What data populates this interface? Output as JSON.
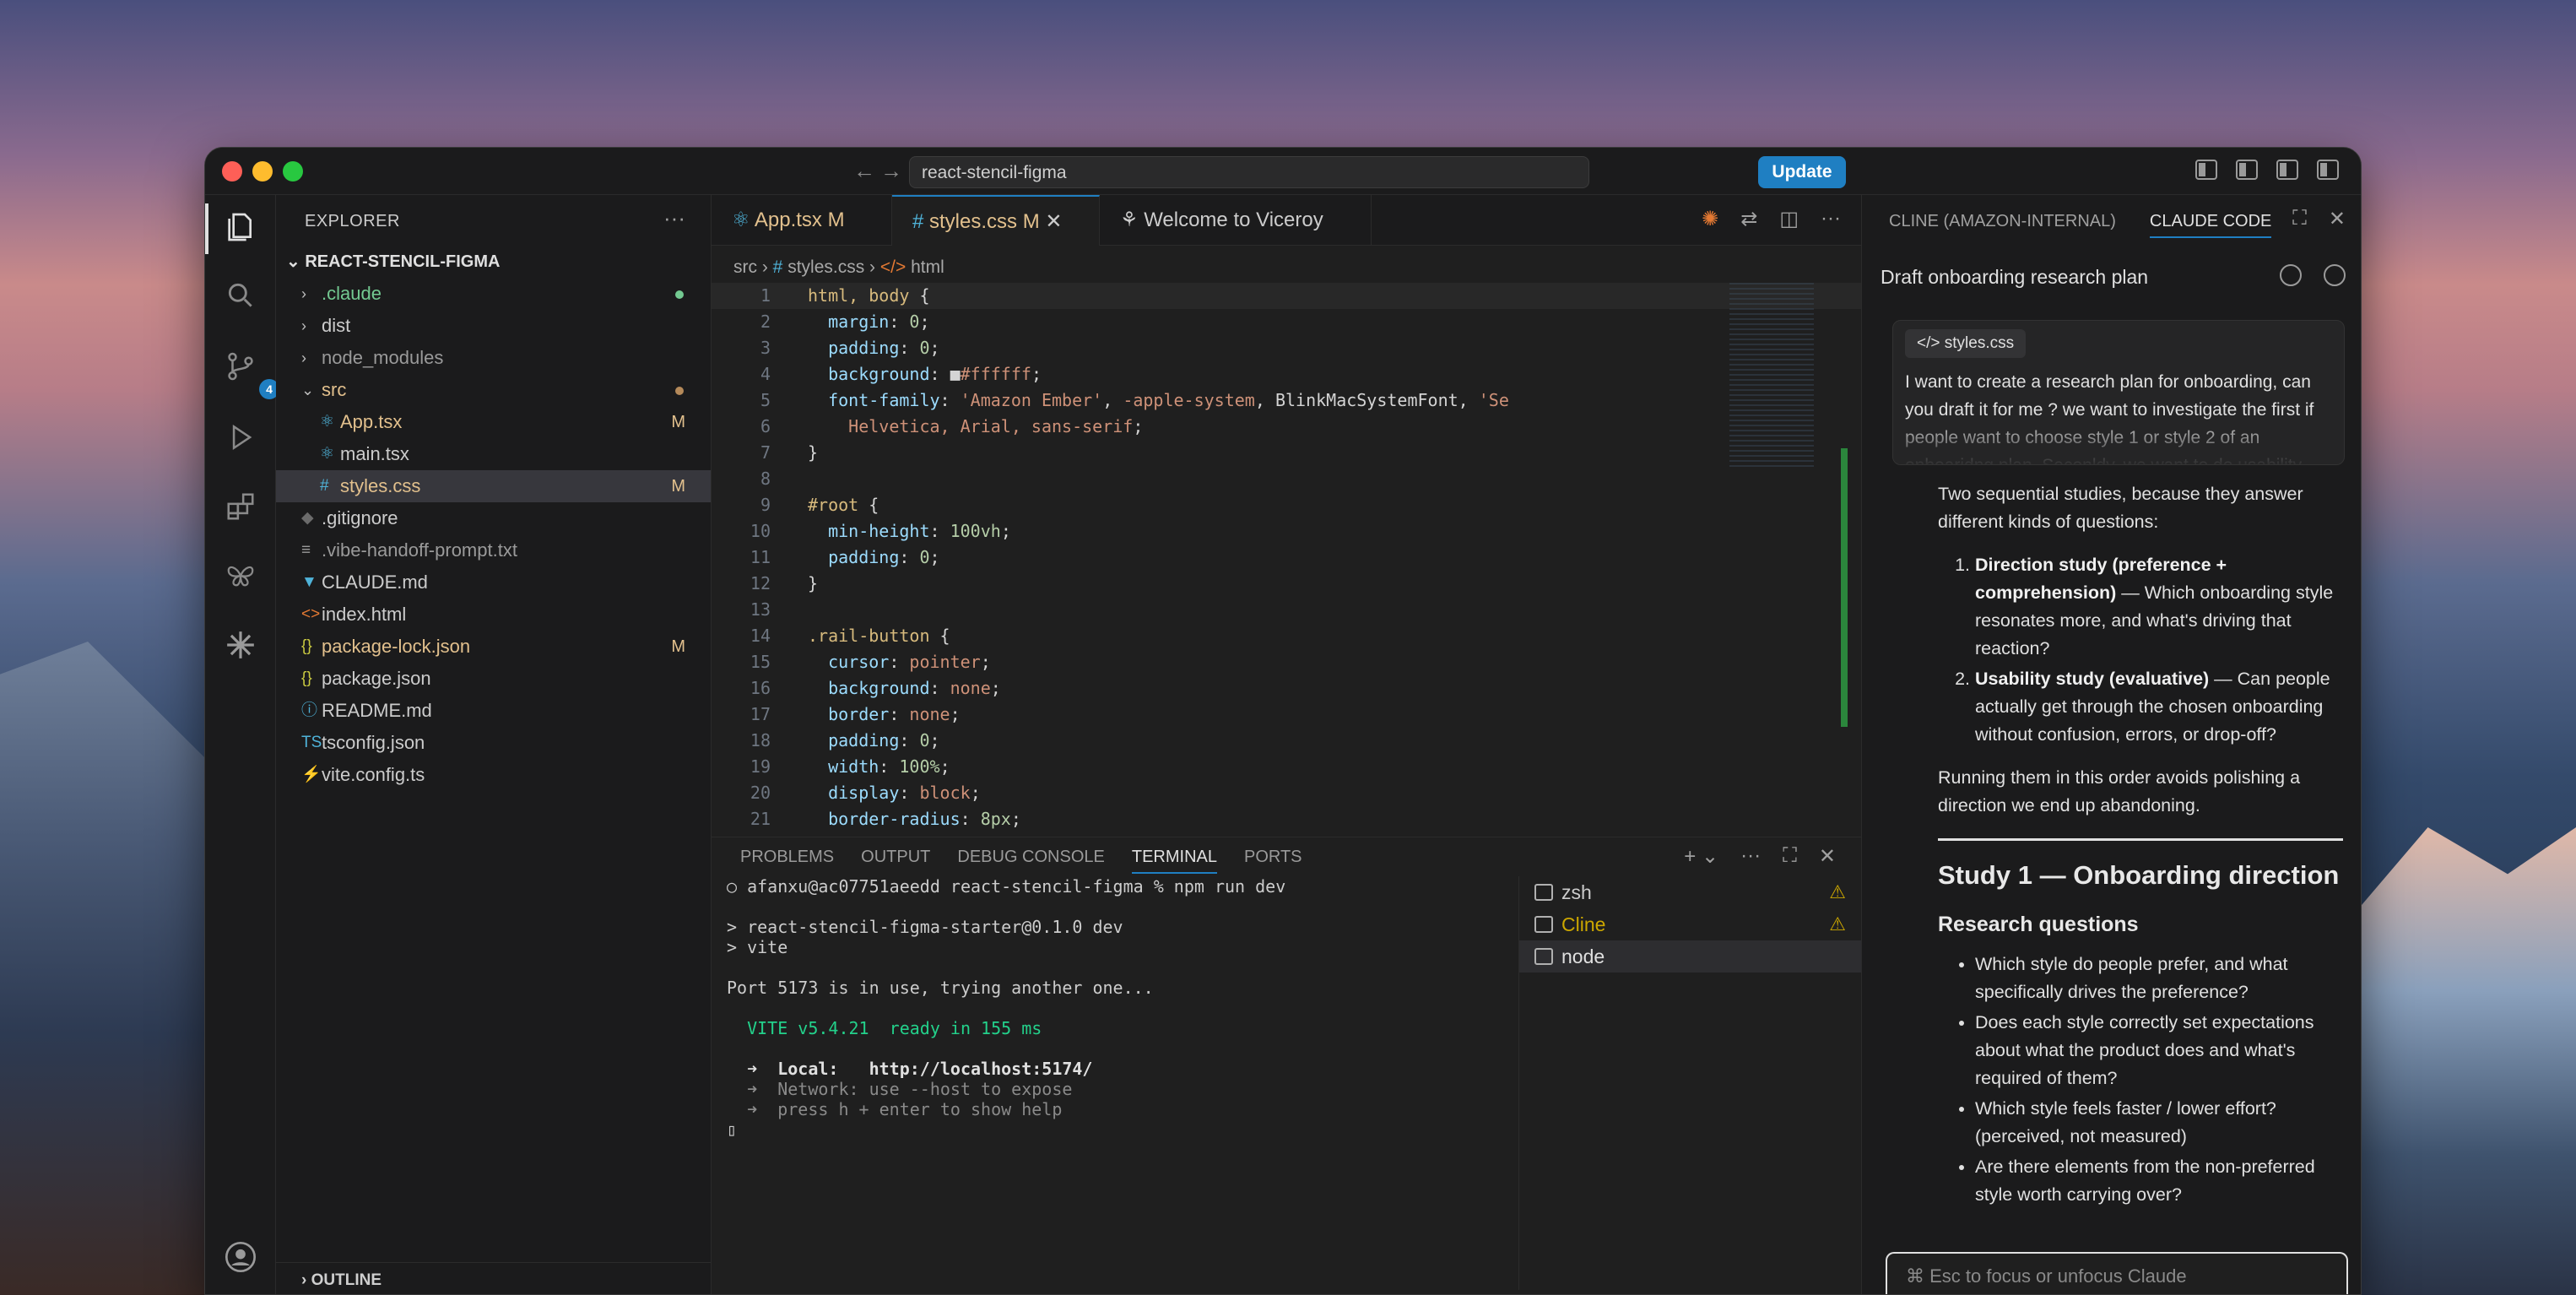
{
  "window": {
    "search_text": "react-stencil-figma",
    "update_label": "Update",
    "nav_back": "←",
    "nav_forward": "→"
  },
  "activity": {
    "source_control_badge": "4"
  },
  "sidebar": {
    "title": "EXPLORER",
    "more": "···",
    "root": "REACT-STENCIL-FIGMA",
    "outline": "OUTLINE",
    "items": [
      {
        "name": ".claude",
        "kind": "folder",
        "color": "#73c991",
        "dot": "#73c991"
      },
      {
        "name": "dist",
        "kind": "folder",
        "color": "#cccccc"
      },
      {
        "name": "node_modules",
        "kind": "folder",
        "color": "#9a9a9a"
      },
      {
        "name": "src",
        "kind": "folder-open",
        "color": "#e2c08d",
        "dot": "#b58a5a"
      },
      {
        "name": "App.tsx",
        "kind": "file",
        "icon": "⚛",
        "icon_color": "#4fb3d9",
        "color": "#e2c08d",
        "mark": "M"
      },
      {
        "name": "main.tsx",
        "kind": "file",
        "icon": "⚛",
        "icon_color": "#4fb3d9",
        "color": "#cccccc"
      },
      {
        "name": "styles.css",
        "kind": "file",
        "icon": "#",
        "icon_color": "#4fb3d9",
        "color": "#e2c08d",
        "mark": "M",
        "selected": true
      },
      {
        "name": ".gitignore",
        "kind": "file",
        "icon": "◆",
        "icon_color": "#6b6b6b",
        "color": "#cccccc"
      },
      {
        "name": ".vibe-handoff-prompt.txt",
        "kind": "file",
        "icon": "≡",
        "icon_color": "#9a9a9a",
        "color": "#9a9a9a"
      },
      {
        "name": "CLAUDE.md",
        "kind": "file",
        "icon": "▼",
        "icon_color": "#4fb3d9",
        "color": "#cccccc"
      },
      {
        "name": "index.html",
        "kind": "file",
        "icon": "<>",
        "icon_color": "#e37933",
        "color": "#cccccc"
      },
      {
        "name": "package-lock.json",
        "kind": "file",
        "icon": "{}",
        "icon_color": "#cbcb41",
        "color": "#e2c08d",
        "mark": "M"
      },
      {
        "name": "package.json",
        "kind": "file",
        "icon": "{}",
        "icon_color": "#cbcb41",
        "color": "#cccccc"
      },
      {
        "name": "README.md",
        "kind": "file",
        "icon": "ⓘ",
        "icon_color": "#4fb3d9",
        "color": "#cccccc"
      },
      {
        "name": "tsconfig.json",
        "kind": "file",
        "icon": "TS",
        "icon_color": "#4fb3d9",
        "color": "#cccccc"
      },
      {
        "name": "vite.config.ts",
        "kind": "file",
        "icon": "⚡",
        "icon_color": "#f0c000",
        "color": "#cccccc"
      }
    ]
  },
  "editor": {
    "tabs": [
      {
        "label": "App.tsx",
        "mark": "M",
        "color": "#e2c08d"
      },
      {
        "label": "styles.css",
        "mark": "M",
        "close": "✕",
        "color": "#e2c08d",
        "active": true
      },
      {
        "label": "Welcome to Viceroy",
        "color": "#cccccc"
      }
    ],
    "breadcrumb": [
      "src",
      "styles.css",
      "html"
    ],
    "code": [
      {
        "n": "1",
        "parts": [
          [
            "k-sel",
            "html, body "
          ],
          [
            "k-pun",
            "{"
          ]
        ]
      },
      {
        "n": "2",
        "parts": [
          [
            "k-prop",
            "  margin"
          ],
          [
            "k-pun",
            ": "
          ],
          [
            "k-num",
            "0"
          ],
          [
            "k-pun",
            ";"
          ]
        ]
      },
      {
        "n": "3",
        "parts": [
          [
            "k-prop",
            "  padding"
          ],
          [
            "k-pun",
            ": "
          ],
          [
            "k-num",
            "0"
          ],
          [
            "k-pun",
            ";"
          ]
        ]
      },
      {
        "n": "4",
        "parts": [
          [
            "k-prop",
            "  background"
          ],
          [
            "k-pun",
            ": "
          ],
          [
            "k-pun",
            "■"
          ],
          [
            "k-str",
            "#ffffff"
          ],
          [
            "k-pun",
            ";"
          ]
        ]
      },
      {
        "n": "5",
        "parts": [
          [
            "k-prop",
            "  font-family"
          ],
          [
            "k-pun",
            ": "
          ],
          [
            "k-str",
            "'Amazon Ember'"
          ],
          [
            "k-pun",
            ", "
          ],
          [
            "k-str",
            "-apple-system"
          ],
          [
            "k-pun",
            ", BlinkMacSystemFont, "
          ],
          [
            "k-str",
            "'Se"
          ]
        ]
      },
      {
        "n": "6",
        "parts": [
          [
            "k-str",
            "    Helvetica, Arial, sans-serif"
          ],
          [
            "k-pun",
            ";"
          ]
        ]
      },
      {
        "n": "7",
        "parts": [
          [
            "k-pun",
            "}"
          ]
        ]
      },
      {
        "n": "8",
        "parts": []
      },
      {
        "n": "9",
        "parts": [
          [
            "k-sel",
            "#root "
          ],
          [
            "k-pun",
            "{"
          ]
        ]
      },
      {
        "n": "10",
        "parts": [
          [
            "k-prop",
            "  min-height"
          ],
          [
            "k-pun",
            ": "
          ],
          [
            "k-num",
            "100vh"
          ],
          [
            "k-pun",
            ";"
          ]
        ]
      },
      {
        "n": "11",
        "parts": [
          [
            "k-prop",
            "  padding"
          ],
          [
            "k-pun",
            ": "
          ],
          [
            "k-num",
            "0"
          ],
          [
            "k-pun",
            ";"
          ]
        ]
      },
      {
        "n": "12",
        "parts": [
          [
            "k-pun",
            "}"
          ]
        ]
      },
      {
        "n": "13",
        "parts": []
      },
      {
        "n": "14",
        "parts": [
          [
            "k-sel",
            ".rail-button "
          ],
          [
            "k-pun",
            "{"
          ]
        ]
      },
      {
        "n": "15",
        "parts": [
          [
            "k-prop",
            "  cursor"
          ],
          [
            "k-pun",
            ": "
          ],
          [
            "k-str",
            "pointer"
          ],
          [
            "k-pun",
            ";"
          ]
        ]
      },
      {
        "n": "16",
        "parts": [
          [
            "k-prop",
            "  background"
          ],
          [
            "k-pun",
            ": "
          ],
          [
            "k-str",
            "none"
          ],
          [
            "k-pun",
            ";"
          ]
        ]
      },
      {
        "n": "17",
        "parts": [
          [
            "k-prop",
            "  border"
          ],
          [
            "k-pun",
            ": "
          ],
          [
            "k-str",
            "none"
          ],
          [
            "k-pun",
            ";"
          ]
        ]
      },
      {
        "n": "18",
        "parts": [
          [
            "k-prop",
            "  padding"
          ],
          [
            "k-pun",
            ": "
          ],
          [
            "k-num",
            "0"
          ],
          [
            "k-pun",
            ";"
          ]
        ]
      },
      {
        "n": "19",
        "parts": [
          [
            "k-prop",
            "  width"
          ],
          [
            "k-pun",
            ": "
          ],
          [
            "k-num",
            "100%"
          ],
          [
            "k-pun",
            ";"
          ]
        ]
      },
      {
        "n": "20",
        "parts": [
          [
            "k-prop",
            "  display"
          ],
          [
            "k-pun",
            ": "
          ],
          [
            "k-str",
            "block"
          ],
          [
            "k-pun",
            ";"
          ]
        ]
      },
      {
        "n": "21",
        "parts": [
          [
            "k-prop",
            "  border-radius"
          ],
          [
            "k-pun",
            ": "
          ],
          [
            "k-num",
            "8px"
          ],
          [
            "k-pun",
            ";"
          ]
        ]
      }
    ]
  },
  "panel": {
    "tabs": [
      "PROBLEMS",
      "OUTPUT",
      "DEBUG CONSOLE",
      "TERMINAL",
      "PORTS"
    ],
    "active_tab": "TERMINAL",
    "terminal_lines": [
      {
        "text": "○ afanxu@ac07751aeedd react-stencil-figma % npm run dev",
        "color": "#cccccc"
      },
      {
        "text": "",
        "color": "#cccccc"
      },
      {
        "text": "> react-stencil-figma-starter@0.1.0 dev",
        "color": "#cccccc"
      },
      {
        "text": "> vite",
        "color": "#cccccc"
      },
      {
        "text": "",
        "color": "#cccccc"
      },
      {
        "text": "Port 5173 is in use, trying another one...",
        "color": "#cccccc"
      },
      {
        "text": "",
        "color": "#cccccc"
      },
      {
        "text": "  VITE v5.4.21  ready in 155 ms",
        "color": "#23d18b"
      },
      {
        "text": "",
        "color": "#cccccc"
      },
      {
        "text": "  ➜  Local:   http://localhost:5174/",
        "color": "#e0e0e0"
      },
      {
        "text": "  ➜  Network: use --host to expose",
        "color": "#8a8a8a"
      },
      {
        "text": "  ➜  press h + enter to show help",
        "color": "#8a8a8a"
      },
      {
        "text": "▯",
        "color": "#cccccc"
      }
    ],
    "terminals": [
      {
        "name": "zsh",
        "color": "#cccccc",
        "warn": "⚠"
      },
      {
        "name": "Cline",
        "color": "#cca700",
        "warn": "⚠"
      },
      {
        "name": "node",
        "color": "#e0e0e0",
        "selected": true
      }
    ]
  },
  "chat": {
    "tabs": [
      "CLINE (AMAZON-INTERNAL)",
      "CLAUDE CODE"
    ],
    "active_tab": "CLAUDE CODE",
    "title": "Draft onboarding research plan",
    "file_chip": "styles.css",
    "prompt": "I want to create a research plan for onboarding, can you draft it for me ? we want to investigate the first if people want to choose style 1 or style 2 of an onboaridng plan. Seconldy, we want to do usability testing",
    "intro": "Two sequential studies, because they answer different kinds of questions:",
    "studies": [
      {
        "bold": "Direction study (preference + comprehension)",
        "rest": " — Which onboarding style resonates more, and what's driving that reaction?"
      },
      {
        "bold": "Usability study (evaluative)",
        "rest": " — Can people actually get through the chosen onboarding without confusion, errors, or drop-off?"
      }
    ],
    "order_note": "Running them in this order avoids polishing a direction we end up abandoning.",
    "study1_heading": "Study 1 — Onboarding direction",
    "rq_heading": "Research questions",
    "questions": [
      "Which style do people prefer, and what specifically drives the preference?",
      "Does each style correctly set expectations about what the product does and what's required of them?",
      "Which style feels faster / lower effort? (perceived, not measured)",
      "Are there elements from the non-preferred style worth carrying over?"
    ],
    "input_placeholder": "⌘ Esc to focus or unfocus Claude"
  }
}
